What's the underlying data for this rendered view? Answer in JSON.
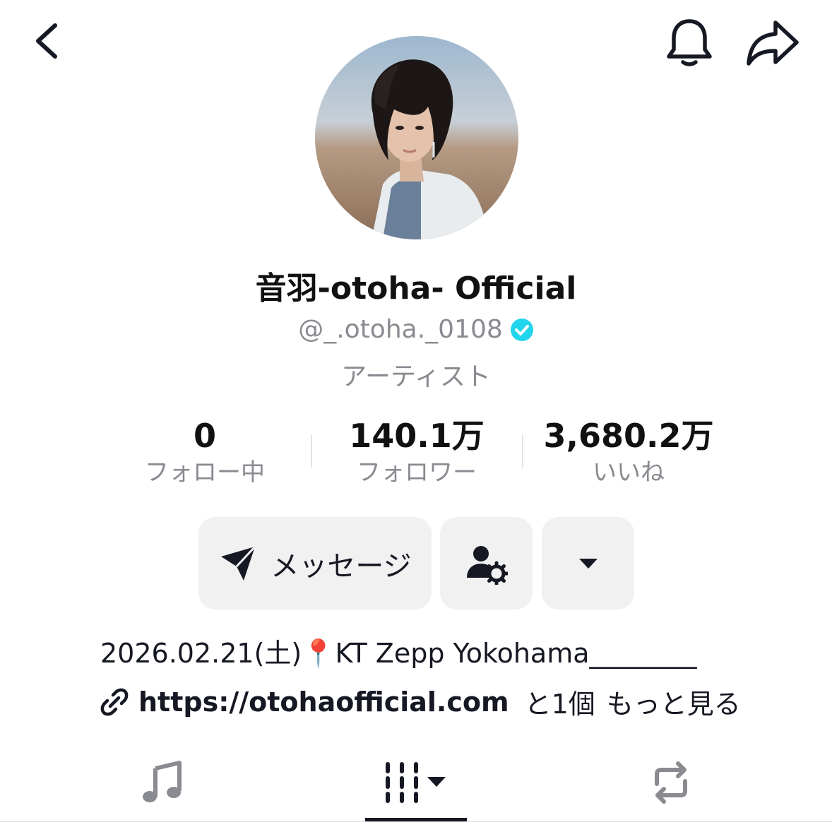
{
  "header": {
    "back_icon": "chevron-left-icon",
    "bell_icon": "bell-icon",
    "share_icon": "share-arrow-icon"
  },
  "profile": {
    "display_name": "音羽-otoha- Official",
    "handle": "@_.otoha._0108",
    "verified": true,
    "verified_color": "#20d5ec",
    "category": "アーティスト"
  },
  "stats": [
    {
      "value": "0",
      "label": "フォロー中"
    },
    {
      "value": "140.1万",
      "label": "フォロワー"
    },
    {
      "value": "3,680.2万",
      "label": "いいね"
    }
  ],
  "actions": {
    "message_label": "メッセージ",
    "message_icon": "paper-plane-icon",
    "friends_icon": "user-settings-icon",
    "more_icon": "caret-down-icon"
  },
  "bio": {
    "text": "2026.02.21(土)📍KT Zepp Yokohama________",
    "link_icon": "link-icon",
    "link_url": "https://otohaofficial.com",
    "link_extra": "と1個",
    "see_more": "もっと見る"
  },
  "tabs": [
    {
      "name": "music",
      "icon": "music-note-icon",
      "active": false
    },
    {
      "name": "videos",
      "icon": "video-grid-icon",
      "active": true
    },
    {
      "name": "reposts",
      "icon": "repost-icon",
      "active": false
    }
  ]
}
